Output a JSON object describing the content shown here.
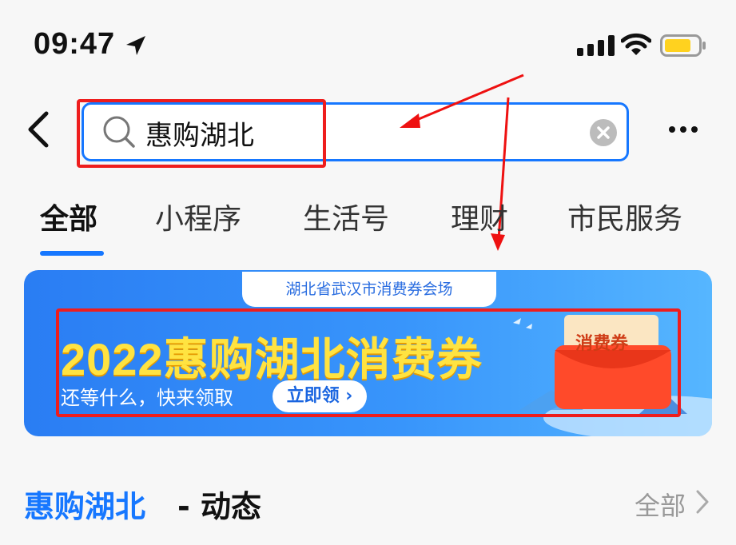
{
  "status_bar": {
    "time": "09:47"
  },
  "search": {
    "query": "惠购湖北"
  },
  "tabs": [
    {
      "label": "全部",
      "active": true
    },
    {
      "label": "小程序"
    },
    {
      "label": "生活号"
    },
    {
      "label": "理财"
    },
    {
      "label": "市民服务"
    }
  ],
  "banner": {
    "venue": "湖北省武汉市消费券会场",
    "title": "2022惠购湖北消费券",
    "subtitle": "还等什么，快来领取",
    "cta": "立即领 ›",
    "coupon_label": "消费券"
  },
  "section": {
    "title": "惠购湖北",
    "subtitle": " - 动态",
    "all_label": "全部"
  },
  "colors": {
    "accent": "#1677ff",
    "highlight": "#ee1d1d",
    "banner_title": "#ffe341"
  },
  "icons": [
    "location-arrow-icon",
    "signal-icon",
    "wifi-icon",
    "battery-icon",
    "back-icon",
    "search-icon",
    "clear-icon",
    "more-icon",
    "chevron-right-icon"
  ]
}
